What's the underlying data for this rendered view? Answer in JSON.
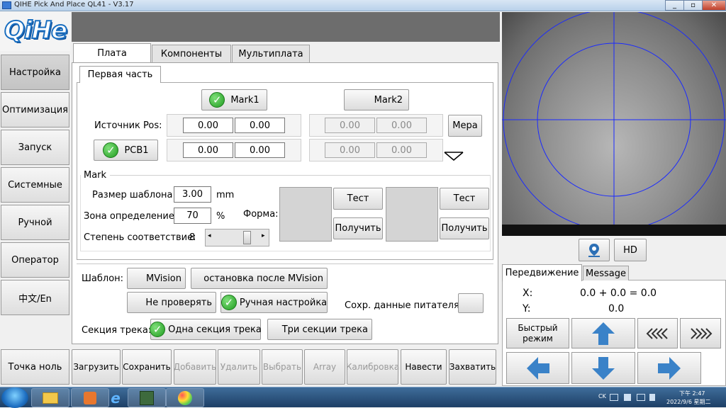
{
  "window": {
    "title": "QIHE Pick And Place  QL41 - V3.17",
    "min": "_",
    "restore": "▫",
    "close": "✕"
  },
  "logo": "QiHe",
  "nav": {
    "items": [
      "Настройка",
      "Оптимизация",
      "Запуск",
      "Системные",
      "Ручной",
      "Оператор",
      "中文/En"
    ],
    "active_index": 0,
    "home": "Точка ноль"
  },
  "tabs": [
    "Плата",
    "Компоненты",
    "Мультиплата"
  ],
  "subtab": "Первая часть",
  "mark_buttons": {
    "mark1": "Mark1",
    "mark2": "Mark2"
  },
  "source": {
    "label": "Источник Pos:",
    "x1": "0.00",
    "y1": "0.00",
    "x2": "0.00",
    "y2": "0.00",
    "measure": "Мера"
  },
  "pcb": {
    "label": "PCB1",
    "x1": "0.00",
    "y1": "0.00",
    "x2": "0.00",
    "y2": "0.00"
  },
  "mark": {
    "title": "Mark",
    "template_size_label": "Размер шаблона:",
    "template_size": "3.00",
    "template_size_unit": "mm",
    "zone_label": "Зона определение:",
    "zone": "70",
    "zone_unit": "%",
    "match_label": "Степень соответствие:",
    "match": "8",
    "shape_label": "Форма:",
    "test": "Тест",
    "get": "Получить"
  },
  "template": {
    "label": "Шаблон:",
    "mvision": "MVision",
    "stop_after": "остановка после MVision",
    "no_check": "Не проверять",
    "manual": "Ручная настройка",
    "feeder_save": "Сохр. данные питателя:"
  },
  "track": {
    "label": "Секция трека:",
    "one": "Одна секция трека",
    "three": "Три секции трека"
  },
  "bottom_buttons": [
    {
      "label": "Загрузить",
      "enabled": true
    },
    {
      "label": "Сохранить",
      "enabled": true
    },
    {
      "label": "Добавить",
      "enabled": false
    },
    {
      "label": "Удалить",
      "enabled": false
    },
    {
      "label": "Выбрать",
      "enabled": false
    },
    {
      "label": "Array",
      "enabled": false
    },
    {
      "label": "Калибровка",
      "enabled": false
    },
    {
      "label": "Навести",
      "enabled": true
    },
    {
      "label": "Захватить",
      "enabled": true
    }
  ],
  "camera": {
    "hd": "HD"
  },
  "move": {
    "tabs": [
      "Передвижение",
      "Message"
    ],
    "x_label": "X:",
    "x_value": "0.0 + 0.0 = 0.0",
    "y_label": "Y:",
    "y_value": "0.0",
    "fast_mode": "Быстрый режим"
  },
  "taskbar": {
    "lang": "CK",
    "time": "下午 2:47",
    "date": "2022/9/6 星期二"
  },
  "colors": {
    "accent": "#1b6fc0",
    "check_green": "#1f9b1f",
    "arrow_blue": "#3a82c8",
    "crosshair": "#1a2aff"
  }
}
